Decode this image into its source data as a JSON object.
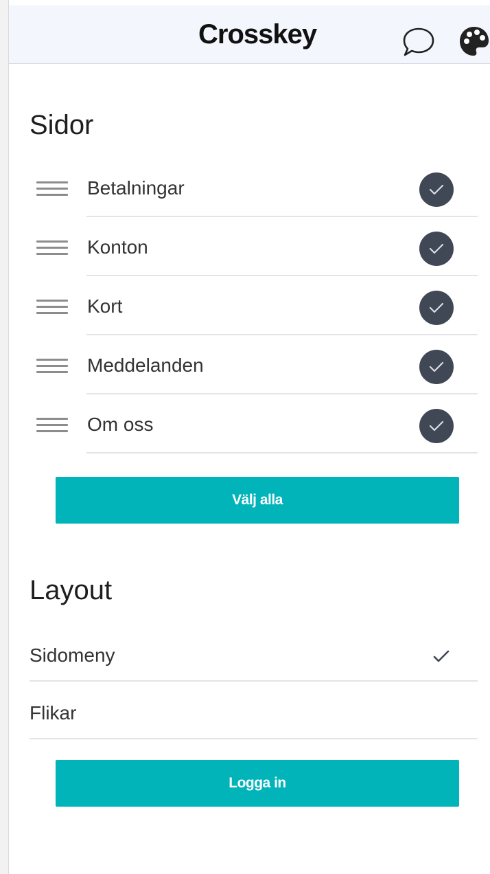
{
  "header": {
    "brand": "Crosskey",
    "icons": [
      "chat-bubble-icon",
      "palette-icon"
    ]
  },
  "pages_section": {
    "title": "Sidor",
    "items": [
      {
        "label": "Betalningar",
        "checked": true
      },
      {
        "label": "Konton",
        "checked": true
      },
      {
        "label": "Kort",
        "checked": true
      },
      {
        "label": "Meddelanden",
        "checked": true
      },
      {
        "label": "Om oss",
        "checked": true
      }
    ],
    "select_all_label": "Välj alla"
  },
  "layout_section": {
    "title": "Layout",
    "options": [
      {
        "label": "Sidomeny",
        "selected": true
      },
      {
        "label": "Flikar",
        "selected": false
      }
    ],
    "login_label": "Logga in"
  },
  "colors": {
    "accent": "#00b4b9",
    "check_circle": "#414855",
    "header_bg": "#f3f6fc"
  }
}
